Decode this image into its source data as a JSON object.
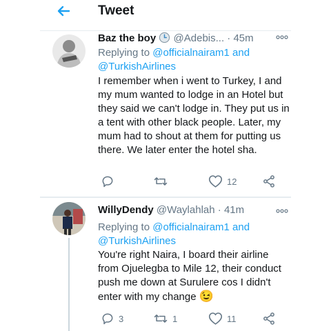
{
  "header": {
    "title": "Tweet"
  },
  "tweets": [
    {
      "name": "Baz the boy",
      "handle": "@Adebis...",
      "time": "· 45m",
      "reply_prefix": "Replying to ",
      "reply_user1": "@officialnairam1",
      "reply_and": " and",
      "reply_user2": "@TurkishAirlines",
      "text": "I remember when i went to Turkey,  I and my mum wanted to lodge in an Hotel but they said we can't lodge in. They put us in a tent with other black people. Later,  my mum had to shout at them for putting us there. We later enter the hotel sha.",
      "replies": "",
      "retweets": "",
      "likes": "12"
    },
    {
      "name": "WillyDendy",
      "handle": "@Waylahlah",
      "time": "· 41m",
      "reply_prefix": "Replying to ",
      "reply_user1": "@officialnairam1",
      "reply_and": " and",
      "reply_user2": "@TurkishAirlines",
      "text": "You're right Naira, I board their airline from Ojuelegba to Mile 12, their conduct push me down at Surulere cos I didn't enter with my change",
      "emoji": "😉",
      "replies": "3",
      "retweets": "1",
      "likes": "11"
    }
  ],
  "colors": {
    "accent": "#1da1f2",
    "muted": "#657786",
    "text": "#14171a",
    "divider": "#e6ecf0"
  },
  "icons": [
    "back-arrow-icon",
    "clock-emoji-icon",
    "more-icon",
    "reply-icon",
    "retweet-icon",
    "like-icon",
    "share-icon",
    "winking-face-emoji"
  ]
}
